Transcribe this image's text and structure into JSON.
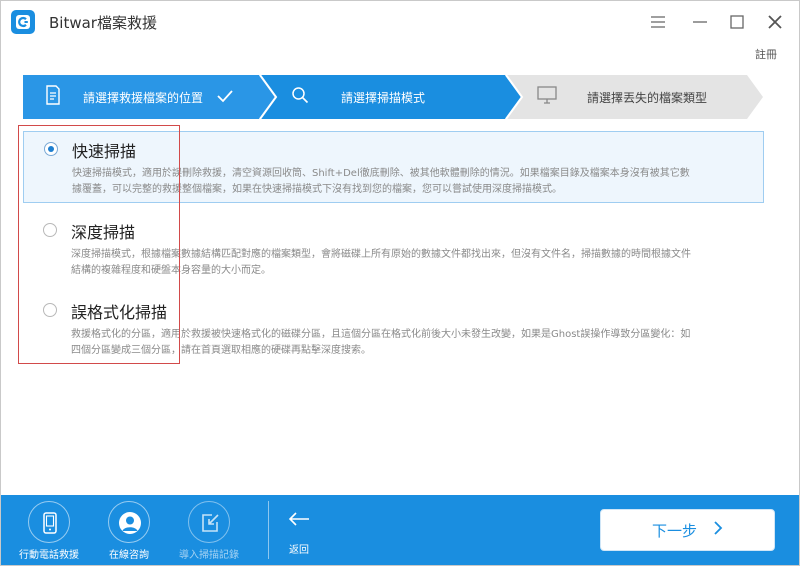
{
  "app": {
    "title": "Bitwar檔案救援"
  },
  "header": {
    "register_label": "註冊"
  },
  "steps": [
    {
      "label": "請選擇救援檔案的位置",
      "state": "done"
    },
    {
      "label": "請選擇掃描模式",
      "state": "active"
    },
    {
      "label": "請選擇丟失的檔案類型",
      "state": "pending"
    }
  ],
  "modes": [
    {
      "title": "快速掃描",
      "selected": true,
      "desc_line1": "快速掃描模式，適用於誤刪除救援，清空資源回收筒、Shift+Del徹底刪除、被其他軟體刪除的情況。如果檔案目錄及檔案本身沒有被其它數",
      "desc_line2": "據覆蓋，可以完整的救援整個檔案，如果在快速掃描模式下沒有找到您的檔案，您可以嘗試使用深度掃描模式。"
    },
    {
      "title": "深度掃描",
      "selected": false,
      "desc_line1": "深度掃描模式，根據檔案數據結構匹配對應的檔案類型，會將磁碟上所有原始的數據文件都找出來，但沒有文件名，掃描數據的時間根據文件",
      "desc_line2": "結構的複雜程度和硬盤本身容量的大小而定。"
    },
    {
      "title": "誤格式化掃描",
      "selected": false,
      "desc_line1": "救援格式化的分區，適用於救援被快速格式化的磁碟分區，且這個分區在格式化前後大小未發生改變，如果是Ghost誤操作導致分區變化：如",
      "desc_line2": "四個分區變成三個分區，請在首頁選取相應的硬碟再點擊深度搜索。"
    }
  ],
  "bottom": {
    "tools": [
      {
        "label": "行動電話救援",
        "icon": "phone-icon"
      },
      {
        "label": "在線咨詢",
        "icon": "user-icon"
      },
      {
        "label": "導入掃描記錄",
        "icon": "import-icon"
      }
    ],
    "back_label": "返回",
    "next_label": "下一步"
  },
  "colors": {
    "accent": "#1a8ee0",
    "step_done": "#2a96e6",
    "highlight": "#d24a4a"
  }
}
